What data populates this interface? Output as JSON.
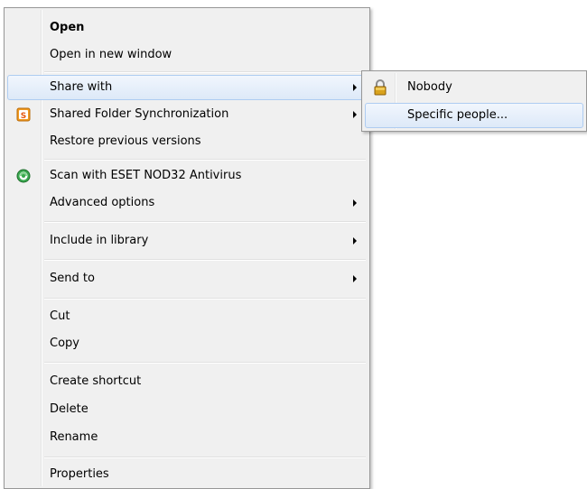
{
  "context_menu": {
    "items": {
      "open": "Open",
      "open_new_window": "Open in new window",
      "share_with": "Share with",
      "shared_folder_sync": "Shared Folder Synchronization",
      "restore_previous": "Restore previous versions",
      "scan_eset": "Scan with ESET NOD32 Antivirus",
      "advanced_options": "Advanced options",
      "include_in_library": "Include in library",
      "send_to": "Send to",
      "cut": "Cut",
      "copy": "Copy",
      "create_shortcut": "Create shortcut",
      "delete": "Delete",
      "rename": "Rename",
      "properties": "Properties"
    },
    "icons": {
      "shared_folder_sync": "shared-folder-sync-icon",
      "scan_eset": "eset-antivirus-icon"
    }
  },
  "share_submenu": {
    "items": {
      "nobody": "Nobody",
      "specific_people": "Specific people..."
    },
    "icons": {
      "nobody": "padlock-icon"
    }
  },
  "colors": {
    "menu_background": "#f0f0f0",
    "menu_border": "#979797",
    "highlight_border": "#aeccf1",
    "highlight_fill": "#dde9f8",
    "eset_green": "#3aa84f",
    "sync_orange": "#f29a1f",
    "lock_gold": "#d9a21c"
  }
}
